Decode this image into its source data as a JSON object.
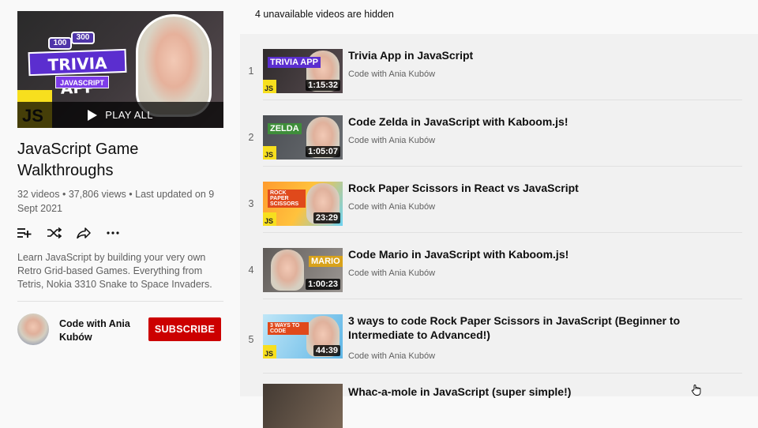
{
  "playlist": {
    "cover": {
      "badge_a": "100",
      "badge_b": "300",
      "cover_title": "TRIVIA APP",
      "cover_tag": "JAVASCRIPT",
      "js_logo": "JS",
      "play_all_label": "PLAY ALL"
    },
    "title": "JavaScript Game Walkthroughs",
    "meta": "32 videos • 37,806 views • Last updated on 9 Sept 2021",
    "description": "Learn JavaScript by building your very own Retro Grid-based Games. Everything from Tetris, Nokia 3310 Snake to Space Invaders.",
    "actions": [
      "add-to-queue-icon",
      "shuffle-icon",
      "share-icon",
      "more-icon"
    ],
    "owner": {
      "name": "Code with Ania Kubów",
      "subscribe_label": "SUBSCRIBE"
    }
  },
  "list": {
    "hidden_note": "4 unavailable videos are hidden",
    "videos": [
      {
        "index": "1",
        "title": "Trivia App in JavaScript",
        "channel": "Code with Ania Kubów",
        "duration": "1:15:32",
        "thumb_caption": "TRIVIA APP"
      },
      {
        "index": "2",
        "title": "Code Zelda in JavaScript with Kaboom.js!",
        "channel": "Code with Ania Kubów",
        "duration": "1:05:07",
        "thumb_caption": "ZELDA"
      },
      {
        "index": "3",
        "title": "Rock Paper Scissors in React vs JavaScript",
        "channel": "Code with Ania Kubów",
        "duration": "23:29",
        "thumb_caption": "ROCK PAPER SCISSORS"
      },
      {
        "index": "4",
        "title": "Code Mario in JavaScript with Kaboom.js!",
        "channel": "Code with Ania Kubów",
        "duration": "1:00:23",
        "thumb_caption": "MARIO"
      },
      {
        "index": "5",
        "title": "3 ways to code Rock Paper Scissors in JavaScript (Beginner to Intermediate to Advanced!)",
        "channel": "Code with Ania Kubów",
        "duration": "44:39",
        "thumb_caption": "3 WAYS TO CODE"
      },
      {
        "index": "",
        "title": "Whac-a-mole in JavaScript (super simple!)",
        "channel": "",
        "duration": "",
        "thumb_caption": ""
      }
    ]
  }
}
